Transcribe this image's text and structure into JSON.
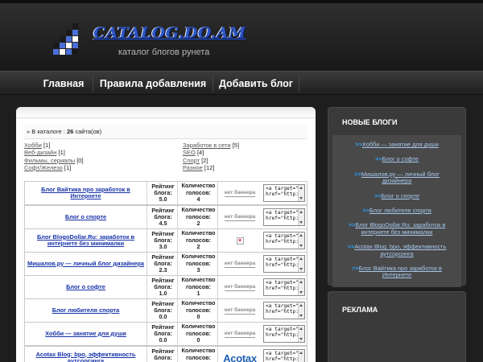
{
  "header": {
    "logo_title": "CATALOG.DO.AM",
    "logo_subtitle": "каталог блогов рунета",
    "logo_grid_colors": [
      "#1a1a1a",
      "#4a6fd8",
      "#ffffff"
    ]
  },
  "nav": {
    "items": [
      {
        "label": "Главная"
      },
      {
        "label": "Правила добавления"
      },
      {
        "label": "Добавить блог"
      }
    ]
  },
  "catalog": {
    "prefix": "» В каталоге : ",
    "count": "26",
    "suffix": " сайта(ов)",
    "left_categories": [
      {
        "name": "Хобби",
        "count": "[1]"
      },
      {
        "name": "Веб-дизайн",
        "count": "[1]"
      },
      {
        "name": "Фильмы, сериалы",
        "count": "[0]"
      },
      {
        "name": "Софт/Железо",
        "count": "[1]"
      }
    ],
    "right_categories": [
      {
        "name": "Заработок в сети",
        "count": "[5]"
      },
      {
        "name": "SEO",
        "count": "[4]"
      },
      {
        "name": "Спорт",
        "count": "[2]"
      },
      {
        "name": "Разное",
        "count": "[12]"
      }
    ]
  },
  "blogs": [
    {
      "title": "Блог Вайтика про заработок в Интернете",
      "rating_label": "Рейтинг блога:",
      "rating": "5.0",
      "votes_label": "Количество голосов:",
      "votes": "4",
      "banner": "нет баннера",
      "code": "<a target=\"_blank\"\nhref=\"http://catalog."
    },
    {
      "title": "Блог о спорте",
      "rating_label": "Рейтинг блога:",
      "rating": "4.5",
      "votes_label": "Количество голосов:",
      "votes": "2",
      "banner": "нет баннера",
      "code": "<a target=\"_blank\"\nhref=\"http://catalog."
    },
    {
      "title": "Блог BlogoDollar.Ru: заработок в интернете без минималки",
      "rating_label": "Рейтинг блога:",
      "rating": "3.0",
      "votes_label": "Количество голосов:",
      "votes": "2",
      "banner": "broken",
      "code": "<a target=\"_blank\"\nhref=\"http://catalog."
    },
    {
      "title": "Мишалов.ру — личный блог дизайнера",
      "rating_label": "Рейтинг блога:",
      "rating": "2.3",
      "votes_label": "Количество голосов:",
      "votes": "3",
      "banner": "нет баннера",
      "code": "<a target=\"_blank\"\nhref=\"http://catalog."
    },
    {
      "title": "Блог о софте",
      "rating_label": "Рейтинг блога:",
      "rating": "1.0",
      "votes_label": "Количество голосов:",
      "votes": "1",
      "banner": "нет баннера",
      "code": "<a target=\"_blank\"\nhref=\"http://catalog."
    },
    {
      "title": "Блог любителя спорта",
      "rating_label": "Рейтинг блога:",
      "rating": "0.0",
      "votes_label": "Количество голосов:",
      "votes": "0",
      "banner": "нет баннера",
      "code": "<a target=\"_blank\"\nhref=\"http://catalog."
    },
    {
      "title": "Хобби — занятие для души",
      "rating_label": "Рейтинг блога:",
      "rating": "0.0",
      "votes_label": "Количество голосов:",
      "votes": "0",
      "banner": "нет баннера",
      "code": "<a target=\"_blank\"\nhref=\"http://catalog."
    },
    {
      "title": "Acotax Blog: bpo, эффективность аутсорсинга",
      "rating_label": "Рейтинг блога:",
      "rating": "0.0",
      "votes_label": "Количество голосов:",
      "votes": "0",
      "banner": "Acotax",
      "code": "<a target=\"_blank\"\nhref=\"http://catalog."
    }
  ],
  "sidebar": {
    "new_blogs_title": "НОВЫЕ БЛОГИ",
    "arrow": ">>",
    "new_blogs": [
      "Хобби — занятие для души",
      "Блог о софте",
      "Мишалов.ру — личный блог дизайнера",
      "Блог о спорте",
      "Блог любителя спорта",
      "Блог BlogoDollar.Ru: заработок в интернете без минималки",
      "Acotax Blog: bpo, эффективность аутсорсинга",
      "Блог Вайтика про заработок в Интернете"
    ],
    "ads_title": "РЕКЛАМА"
  }
}
